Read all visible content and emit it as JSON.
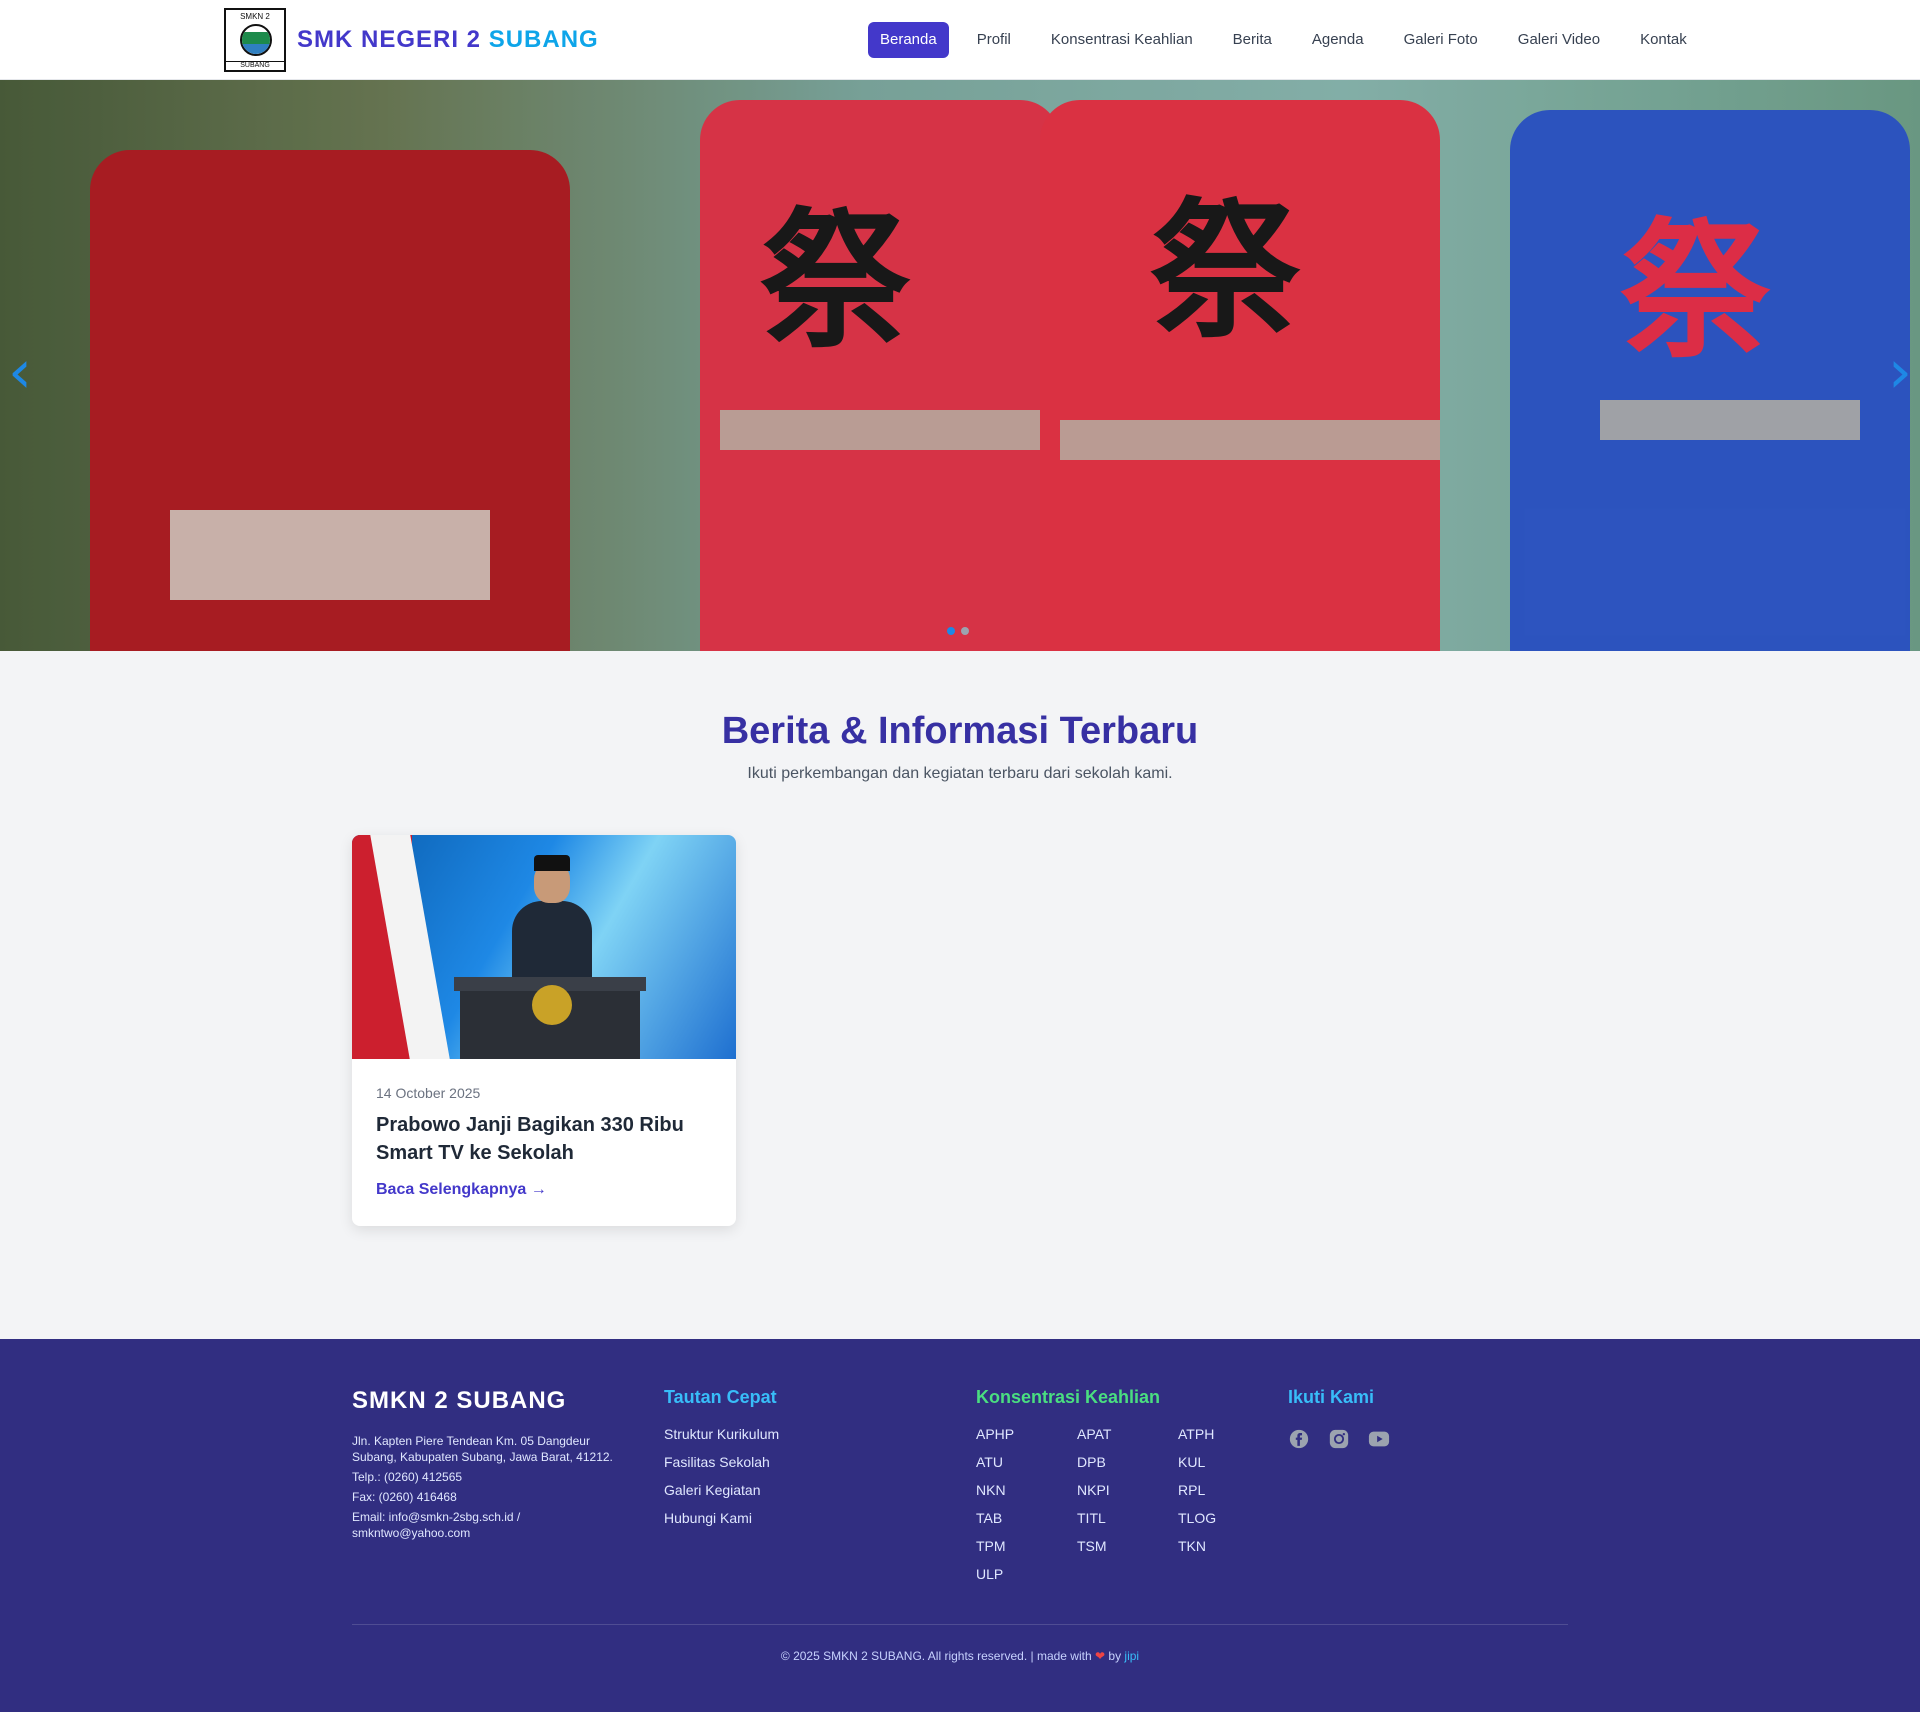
{
  "header": {
    "logo_top": "SMKN 2",
    "logo_bottom": "SUBANG",
    "site_name_a": "SMK NEGERI 2",
    "site_name_b": "SUBANG",
    "nav": [
      {
        "label": "Beranda",
        "active": true
      },
      {
        "label": "Profil"
      },
      {
        "label": "Konsentrasi Keahlian"
      },
      {
        "label": "Berita"
      },
      {
        "label": "Agenda"
      },
      {
        "label": "Galeri Foto"
      },
      {
        "label": "Galeri Video"
      },
      {
        "label": "Kontak"
      }
    ]
  },
  "hero": {
    "prev_icon": "chevron-left-icon",
    "next_icon": "chevron-right-icon",
    "slides_total": 2,
    "active_slide": 1
  },
  "news": {
    "title": "Berita & Informasi Terbaru",
    "subtitle": "Ikuti perkembangan dan kegiatan terbaru dari sekolah kami.",
    "cards": [
      {
        "date": "14 October 2025",
        "title": "Prabowo Janji Bagikan 330 Ribu Smart TV ke Sekolah",
        "link": "Baca Selengkapnya →"
      }
    ]
  },
  "footer": {
    "brand": "SMKN 2 SUBANG",
    "address": "Jln. Kapten Piere Tendean Km. 05 Dangdeur Subang, Kabupaten Subang, Jawa Barat, 41212.",
    "phone": "Telp.: (0260) 412565",
    "fax": "Fax: (0260) 416468",
    "email": "Email: info@smkn-2sbg.sch.id / smkntwo@yahoo.com",
    "quick_links_title": "Tautan Cepat",
    "quick_links": [
      "Struktur Kurikulum",
      "Fasilitas Sekolah",
      "Galeri Kegiatan",
      "Hubungi Kami"
    ],
    "programs_title": "Konsentrasi Keahlian",
    "programs": [
      "APHP",
      "APAT",
      "ATPH",
      "ATU",
      "DPB",
      "KUL",
      "NKN",
      "NKPI",
      "RPL",
      "TAB",
      "TITL",
      "TLOG",
      "TPM",
      "TSM",
      "TKN",
      "ULP"
    ],
    "follow_title": "Ikuti Kami",
    "social_icons": [
      "facebook-icon",
      "instagram-icon",
      "youtube-icon"
    ],
    "copyright": "© 2025 SMKN 2 SUBANG. All rights reserved. | made with",
    "by_label": "by",
    "author": "jipi",
    "colors": {
      "bg": "#312e81",
      "accent_blue": "#38bdf8",
      "accent_green": "#4ade80"
    }
  }
}
